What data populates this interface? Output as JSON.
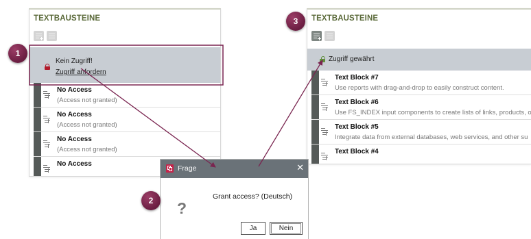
{
  "left_panel": {
    "title": "TEXTBAUSTEINE",
    "access_status": "Kein Zugriff!",
    "access_request_link": "Zugriff anfordern",
    "items": [
      {
        "title": "No Access",
        "subtitle": "(Access not granted)"
      },
      {
        "title": "No Access",
        "subtitle": "(Access not granted)"
      },
      {
        "title": "No Access",
        "subtitle": "(Access not granted)"
      },
      {
        "title": "No Access",
        "subtitle": ""
      }
    ]
  },
  "right_panel": {
    "title": "TEXTBAUSTEINE",
    "access_status": "Zugriff gewährt",
    "items": [
      {
        "title": "Text Block #7",
        "subtitle": "Use reports with drag-and-drop to easily construct content."
      },
      {
        "title": "Text Block #6",
        "subtitle": "Use FS_INDEX input components to create lists of links, products, o"
      },
      {
        "title": "Text Block #5",
        "subtitle": "Integrate data from external databases, web services, and other su"
      },
      {
        "title": "Text Block #4",
        "subtitle": ""
      }
    ]
  },
  "dialog": {
    "title": "Frage",
    "close_glyph": "✕",
    "question": "Grant access? (Deutsch)",
    "question_icon": "?",
    "yes_label": "Ja",
    "no_label": "Nein"
  },
  "steps": [
    "1",
    "2",
    "3"
  ],
  "colors": {
    "accent_title": "#5b6a3a",
    "step_badge": "#7a2550",
    "arrow": "#7a2550",
    "lock_denied": "#b21a2a",
    "lock_granted": "#5f8f3c",
    "highlight_box": "#7a2550",
    "dialog_header": "#6a7278"
  }
}
